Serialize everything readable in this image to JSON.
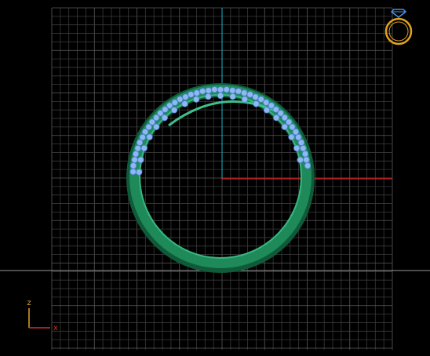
{
  "viewport": {
    "background": "#000000",
    "grid_color": "#5a5a5a",
    "minor_grid_color": "#3a3a3a",
    "horizon_color": "#9a9a9a"
  },
  "axes": {
    "vertical_color": "#1fb0c8",
    "horizontal_color": "#c81818"
  },
  "ring": {
    "band_color": "#1e8a5a",
    "band_highlight": "#3fc08a",
    "band_shadow": "#0f5a38",
    "stone_color": "#8fb8f0",
    "stone_outline": "#4a7fd0",
    "prong_color": "#2aa070"
  },
  "orientation_icon": {
    "name": "ring-view-icon",
    "ring_color": "#e0a020",
    "gem_color": "#4a90e0"
  },
  "axis_triad": {
    "z_label": "z",
    "x_label": "x",
    "z_color": "#e0a020",
    "x_color": "#d03030"
  }
}
